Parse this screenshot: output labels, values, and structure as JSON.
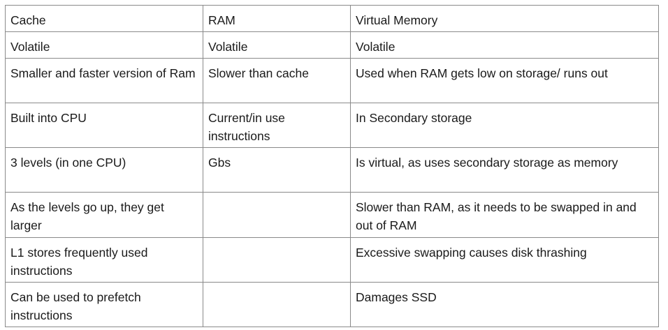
{
  "table": {
    "header": [
      "Cache",
      "RAM",
      "Virtual Memory"
    ],
    "rows": [
      [
        "Volatile",
        "Volatile",
        "Volatile"
      ],
      [
        "Smaller and faster version of Ram",
        "Slower than cache",
        "Used when RAM gets low on storage/ runs out"
      ],
      [
        "Built into CPU",
        "Current/in use instructions",
        "In Secondary storage"
      ],
      [
        "3 levels (in one CPU)",
        "Gbs",
        "Is virtual, as uses secondary storage as memory"
      ],
      [
        "As the levels go up, they get larger",
        "",
        "Slower than RAM, as it needs to be swapped in and out of RAM"
      ],
      [
        "L1 stores frequently used instructions",
        "",
        "Excessive swapping causes disk thrashing"
      ],
      [
        "Can be used to prefetch instructions",
        "",
        "Damages SSD"
      ]
    ]
  }
}
